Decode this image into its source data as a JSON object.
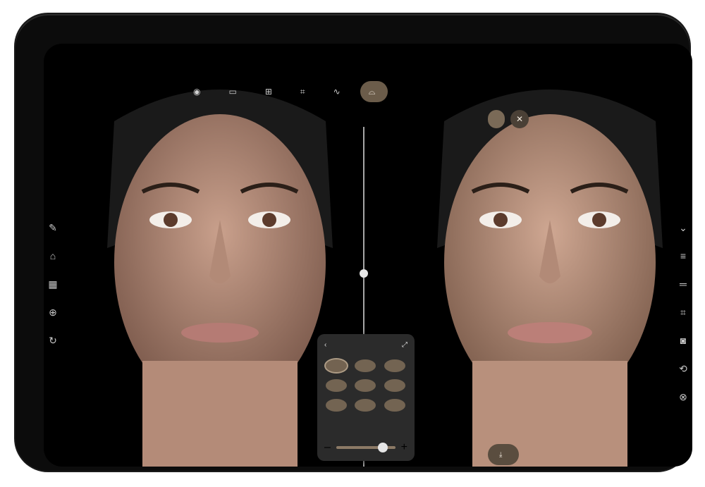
{
  "toolbar": {
    "tabs": [
      {
        "icon": "face-icon",
        "label": "",
        "active": false
      },
      {
        "icon": "measure-icon",
        "label": "",
        "active": false
      },
      {
        "icon": "compare-icon",
        "label": "",
        "active": false
      },
      {
        "icon": "volume-icon",
        "label": "",
        "active": false
      },
      {
        "icon": "curve-icon",
        "label": "",
        "active": false
      },
      {
        "icon": "lips-icon",
        "label": "",
        "active": true
      }
    ]
  },
  "subbar": {
    "chip_label": "",
    "close_icon": "close-icon"
  },
  "left_tools": [
    {
      "icon": "brush-icon"
    },
    {
      "icon": "home-icon"
    },
    {
      "icon": "grid-icon"
    },
    {
      "icon": "lock-icon"
    },
    {
      "icon": "refresh-icon"
    }
  ],
  "right_tools": [
    {
      "icon": "chevron-down-icon"
    },
    {
      "icon": "layers-icon"
    },
    {
      "icon": "equals-icon"
    },
    {
      "icon": "crop-icon"
    },
    {
      "icon": "camera-icon"
    },
    {
      "icon": "rotate-icon"
    },
    {
      "icon": "lock-icon"
    }
  ],
  "lip_panel": {
    "title": "",
    "selected_index": 0,
    "slider_level": 0.7,
    "items": [
      {},
      {},
      {},
      {},
      {},
      {},
      {},
      {},
      {}
    ]
  },
  "bottom_action": {
    "label": ""
  },
  "watermark": {
    "label": ""
  },
  "colors": {
    "accent": "#6b5c4a",
    "panel": "#2b2b2b"
  }
}
